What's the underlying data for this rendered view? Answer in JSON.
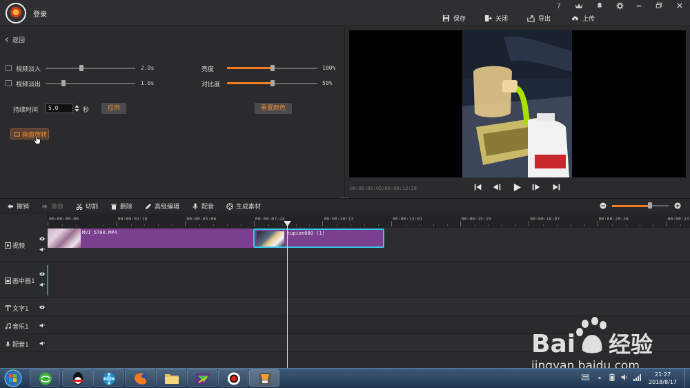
{
  "titlebar": {
    "login": "登录",
    "actions": [
      {
        "label": "保存",
        "icon": "save-icon"
      },
      {
        "label": "关闭",
        "icon": "close-project-icon"
      },
      {
        "label": "导出",
        "icon": "export-icon"
      },
      {
        "label": "上传",
        "icon": "upload-icon"
      }
    ],
    "window_controls": [
      "help-icon",
      "vip-icon",
      "bell-icon",
      "gear-icon",
      "minimize-icon",
      "maximize-icon",
      "close-icon"
    ],
    "help": "?"
  },
  "left_panel": {
    "back": "返回",
    "fade_in": {
      "label": "视频淡入",
      "value": "2.0s",
      "checked": false,
      "level": 0.5
    },
    "fade_out": {
      "label": "视频淡出",
      "value": "1.0s",
      "checked": false,
      "level": 0.2
    },
    "brightness": {
      "label": "亮度",
      "value": "100%",
      "level": 0.5
    },
    "contrast": {
      "label": "对比度",
      "value": "50%",
      "level": 0.5
    },
    "duration": {
      "label": "持续时间",
      "value": "5.0",
      "unit": "秒"
    },
    "apply": "应用",
    "reset_color": "重置颜色",
    "rotate": "画面旋转"
  },
  "preview": {
    "time": "00:00:09:05/00:00:12:26",
    "controls": [
      "skip-start-icon",
      "step-back-icon",
      "play-icon",
      "step-forward-icon",
      "skip-end-icon"
    ]
  },
  "toolbar": {
    "items": [
      {
        "label": "撤销",
        "icon": "undo-icon",
        "enabled": true
      },
      {
        "label": "重做",
        "icon": "redo-icon",
        "enabled": false
      },
      {
        "label": "切割",
        "icon": "scissors-icon",
        "enabled": true
      },
      {
        "label": "删除",
        "icon": "trash-icon",
        "enabled": true
      },
      {
        "label": "高级编辑",
        "icon": "pencil-icon",
        "enabled": true
      },
      {
        "label": "配音",
        "icon": "mic-icon",
        "enabled": true
      },
      {
        "label": "生成素材",
        "icon": "film-reel-icon",
        "enabled": true
      }
    ],
    "zoom_level": 0.85
  },
  "timeline": {
    "ticks": [
      "00:00:00:00",
      "00:00:02:18",
      "00:00:05:06",
      "00:00:07:24",
      "00:00:10:13",
      "00:00:13:01",
      "00:00:15:19",
      "00:00:18:07",
      "00:00:20:26",
      "00:00:23:"
    ],
    "tracks": [
      {
        "label": "视频",
        "icon": "play-square-icon"
      },
      {
        "label": "画中画1",
        "icon": "pip-icon"
      },
      {
        "label": "文字1",
        "icon": "text-icon"
      },
      {
        "label": "音乐1",
        "icon": "music-icon"
      },
      {
        "label": "配音1",
        "icon": "mic-icon"
      }
    ],
    "clips": [
      {
        "name": "MVI_5700.MP4",
        "color": "#7a3f8f"
      },
      {
        "name": "tupian000 (1)",
        "color": "#7a3f8f",
        "selected_border": "#37c6e8"
      }
    ]
  },
  "taskbar": {
    "apps": [
      "start-orb-icon",
      "360-icon",
      "qq-icon",
      "video-player-icon",
      "firefox-icon",
      "folder-icon",
      "media-app-icon",
      "record-icon",
      "editor-app-icon"
    ],
    "time": "21:27",
    "date": "2018/8/17"
  },
  "watermark": {
    "brand": "Bai",
    "brand2": "经验",
    "url": "jingyan.baidu.com"
  },
  "colors": {
    "accent": "#f07d22",
    "clip": "#7a3f8f",
    "selection": "#37c6e8"
  }
}
